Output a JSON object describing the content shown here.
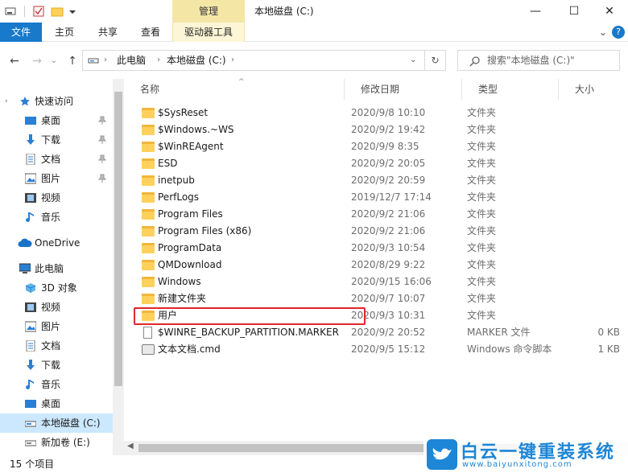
{
  "title_bar": {
    "contextual_tab": "管理",
    "window_title": "本地磁盘 (C:)",
    "min_glyph": "—",
    "max_glyph": "☐",
    "close_glyph": "✕"
  },
  "ribbon": {
    "tabs": [
      "文件",
      "主页",
      "共享",
      "查看",
      "驱动器工具"
    ],
    "collapse_glyph": "⌄",
    "help_glyph": "?"
  },
  "nav": {
    "back_glyph": "←",
    "forward_glyph": "→",
    "recent_glyph": "⌄",
    "up_glyph": "↑",
    "breadcrumb": [
      "此电脑",
      "本地磁盘 (C:)"
    ],
    "breadcrumb_sep": "›",
    "dropdown_glyph": "⌄",
    "refresh_glyph": "↻",
    "search_placeholder": "搜索\"本地磁盘 (C:)\""
  },
  "sidebar": {
    "quick_access": "快速访问",
    "quick_items": [
      "桌面",
      "下载",
      "文档",
      "图片",
      "视频",
      "音乐"
    ],
    "onedrive": "OneDrive",
    "this_pc": "此电脑",
    "pc_items": [
      "3D 对象",
      "视频",
      "图片",
      "文档",
      "下载",
      "音乐",
      "桌面",
      "本地磁盘 (C:)",
      "新加卷 (E:)"
    ]
  },
  "columns": {
    "name": "名称",
    "date": "修改日期",
    "type": "类型",
    "size": "大小"
  },
  "files": [
    {
      "name": "$SysReset",
      "date": "2020/9/8 10:10",
      "type": "文件夹",
      "size": "",
      "icon": "folder-icon"
    },
    {
      "name": "$Windows.~WS",
      "date": "2020/9/2 19:42",
      "type": "文件夹",
      "size": "",
      "icon": "folder-icon"
    },
    {
      "name": "$WinREAgent",
      "date": "2020/9/9 8:35",
      "type": "文件夹",
      "size": "",
      "icon": "folder-icon"
    },
    {
      "name": "ESD",
      "date": "2020/9/2 20:05",
      "type": "文件夹",
      "size": "",
      "icon": "folder-icon"
    },
    {
      "name": "inetpub",
      "date": "2020/9/2 20:59",
      "type": "文件夹",
      "size": "",
      "icon": "folder-icon"
    },
    {
      "name": "PerfLogs",
      "date": "2019/12/7 17:14",
      "type": "文件夹",
      "size": "",
      "icon": "folder-icon"
    },
    {
      "name": "Program Files",
      "date": "2020/9/2 21:06",
      "type": "文件夹",
      "size": "",
      "icon": "folder-icon"
    },
    {
      "name": "Program Files (x86)",
      "date": "2020/9/2 21:06",
      "type": "文件夹",
      "size": "",
      "icon": "folder-icon"
    },
    {
      "name": "ProgramData",
      "date": "2020/9/3 10:54",
      "type": "文件夹",
      "size": "",
      "icon": "folder-icon"
    },
    {
      "name": "QMDownload",
      "date": "2020/8/29 9:22",
      "type": "文件夹",
      "size": "",
      "icon": "folder-icon"
    },
    {
      "name": "Windows",
      "date": "2020/9/15 16:06",
      "type": "文件夹",
      "size": "",
      "icon": "folder-icon"
    },
    {
      "name": "新建文件夹",
      "date": "2020/9/7 10:07",
      "type": "文件夹",
      "size": "",
      "icon": "folder-icon"
    },
    {
      "name": "用户",
      "date": "2020/9/3 10:31",
      "type": "文件夹",
      "size": "",
      "icon": "folder-icon"
    },
    {
      "name": "$WINRE_BACKUP_PARTITION.MARKER",
      "date": "2020/9/2 20:52",
      "type": "MARKER 文件",
      "size": "0 KB",
      "icon": "file-icon"
    },
    {
      "name": "文本文档.cmd",
      "date": "2020/9/5 15:12",
      "type": "Windows 命令脚本",
      "size": "1 KB",
      "icon": "cmd-file-icon"
    }
  ],
  "status": {
    "item_count": "15 个项目"
  },
  "watermark": {
    "brand": "白云一键重装系统",
    "url": "www.baiyunxitong.com"
  },
  "colors": {
    "accent": "#1979ca",
    "contextual": "#f4e7a6",
    "highlight_box": "#e0262b",
    "folder": "#ffd15c",
    "selected": "#cce8ff"
  }
}
